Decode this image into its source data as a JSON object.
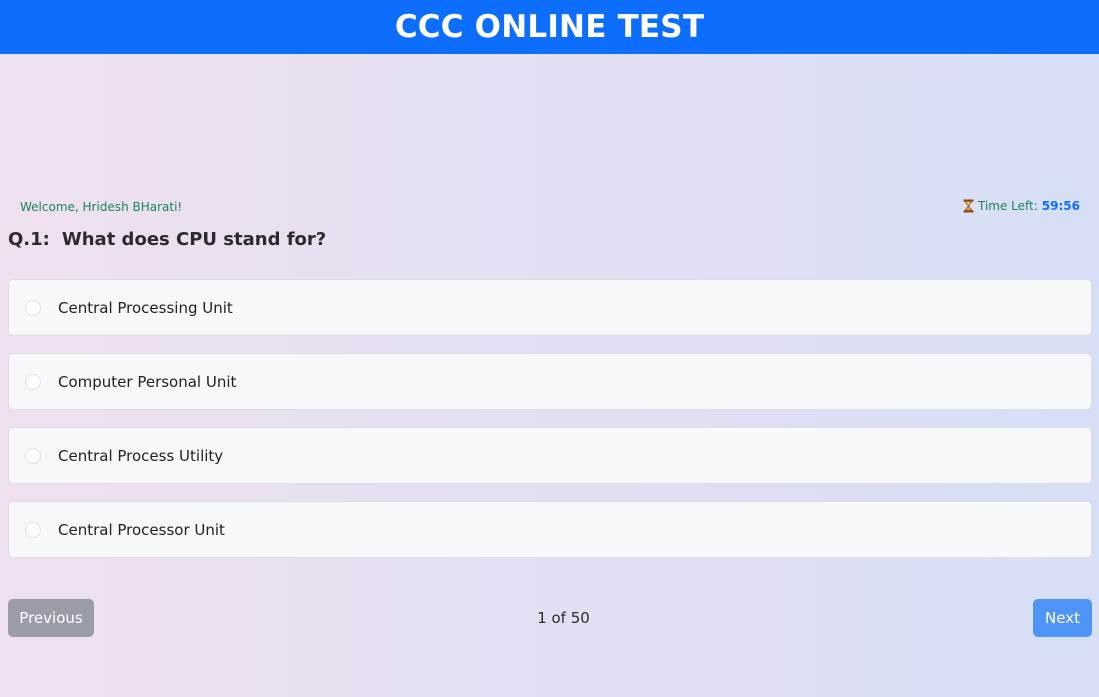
{
  "header": {
    "title": "CCC ONLINE TEST"
  },
  "user": {
    "welcome": "Welcome, Hridesh BHarati!"
  },
  "timer": {
    "label": "Time Left:",
    "value": "59:56",
    "icon": "hourglass-icon"
  },
  "question": {
    "number": "Q.1:",
    "text": "What does CPU stand for?"
  },
  "options": [
    {
      "label": "Central Processing Unit",
      "selected": false
    },
    {
      "label": "Computer Personal Unit",
      "selected": false
    },
    {
      "label": "Central Process Utility",
      "selected": false
    },
    {
      "label": "Central Processor Unit",
      "selected": false
    }
  ],
  "navigation": {
    "previous_label": "Previous",
    "next_label": "Next",
    "page_indicator": "1 of 50"
  },
  "colors": {
    "header_bg": "#0d6efd",
    "accent_green": "#198754",
    "timer_blue": "#0d6efd",
    "previous_button": "#9a9ca8",
    "next_button": "#4f95f7"
  }
}
